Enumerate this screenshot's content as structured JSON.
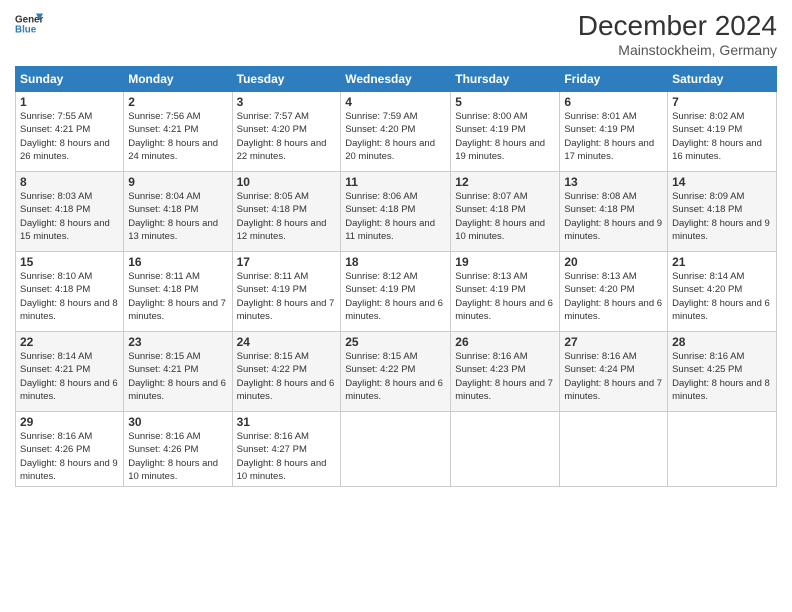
{
  "header": {
    "logo_line1": "General",
    "logo_line2": "Blue",
    "month": "December 2024",
    "location": "Mainstockheim, Germany"
  },
  "days_of_week": [
    "Sunday",
    "Monday",
    "Tuesday",
    "Wednesday",
    "Thursday",
    "Friday",
    "Saturday"
  ],
  "weeks": [
    [
      {
        "day": "1",
        "sunrise": "Sunrise: 7:55 AM",
        "sunset": "Sunset: 4:21 PM",
        "daylight": "Daylight: 8 hours and 26 minutes."
      },
      {
        "day": "2",
        "sunrise": "Sunrise: 7:56 AM",
        "sunset": "Sunset: 4:21 PM",
        "daylight": "Daylight: 8 hours and 24 minutes."
      },
      {
        "day": "3",
        "sunrise": "Sunrise: 7:57 AM",
        "sunset": "Sunset: 4:20 PM",
        "daylight": "Daylight: 8 hours and 22 minutes."
      },
      {
        "day": "4",
        "sunrise": "Sunrise: 7:59 AM",
        "sunset": "Sunset: 4:20 PM",
        "daylight": "Daylight: 8 hours and 20 minutes."
      },
      {
        "day": "5",
        "sunrise": "Sunrise: 8:00 AM",
        "sunset": "Sunset: 4:19 PM",
        "daylight": "Daylight: 8 hours and 19 minutes."
      },
      {
        "day": "6",
        "sunrise": "Sunrise: 8:01 AM",
        "sunset": "Sunset: 4:19 PM",
        "daylight": "Daylight: 8 hours and 17 minutes."
      },
      {
        "day": "7",
        "sunrise": "Sunrise: 8:02 AM",
        "sunset": "Sunset: 4:19 PM",
        "daylight": "Daylight: 8 hours and 16 minutes."
      }
    ],
    [
      {
        "day": "8",
        "sunrise": "Sunrise: 8:03 AM",
        "sunset": "Sunset: 4:18 PM",
        "daylight": "Daylight: 8 hours and 15 minutes."
      },
      {
        "day": "9",
        "sunrise": "Sunrise: 8:04 AM",
        "sunset": "Sunset: 4:18 PM",
        "daylight": "Daylight: 8 hours and 13 minutes."
      },
      {
        "day": "10",
        "sunrise": "Sunrise: 8:05 AM",
        "sunset": "Sunset: 4:18 PM",
        "daylight": "Daylight: 8 hours and 12 minutes."
      },
      {
        "day": "11",
        "sunrise": "Sunrise: 8:06 AM",
        "sunset": "Sunset: 4:18 PM",
        "daylight": "Daylight: 8 hours and 11 minutes."
      },
      {
        "day": "12",
        "sunrise": "Sunrise: 8:07 AM",
        "sunset": "Sunset: 4:18 PM",
        "daylight": "Daylight: 8 hours and 10 minutes."
      },
      {
        "day": "13",
        "sunrise": "Sunrise: 8:08 AM",
        "sunset": "Sunset: 4:18 PM",
        "daylight": "Daylight: 8 hours and 9 minutes."
      },
      {
        "day": "14",
        "sunrise": "Sunrise: 8:09 AM",
        "sunset": "Sunset: 4:18 PM",
        "daylight": "Daylight: 8 hours and 9 minutes."
      }
    ],
    [
      {
        "day": "15",
        "sunrise": "Sunrise: 8:10 AM",
        "sunset": "Sunset: 4:18 PM",
        "daylight": "Daylight: 8 hours and 8 minutes."
      },
      {
        "day": "16",
        "sunrise": "Sunrise: 8:11 AM",
        "sunset": "Sunset: 4:18 PM",
        "daylight": "Daylight: 8 hours and 7 minutes."
      },
      {
        "day": "17",
        "sunrise": "Sunrise: 8:11 AM",
        "sunset": "Sunset: 4:19 PM",
        "daylight": "Daylight: 8 hours and 7 minutes."
      },
      {
        "day": "18",
        "sunrise": "Sunrise: 8:12 AM",
        "sunset": "Sunset: 4:19 PM",
        "daylight": "Daylight: 8 hours and 6 minutes."
      },
      {
        "day": "19",
        "sunrise": "Sunrise: 8:13 AM",
        "sunset": "Sunset: 4:19 PM",
        "daylight": "Daylight: 8 hours and 6 minutes."
      },
      {
        "day": "20",
        "sunrise": "Sunrise: 8:13 AM",
        "sunset": "Sunset: 4:20 PM",
        "daylight": "Daylight: 8 hours and 6 minutes."
      },
      {
        "day": "21",
        "sunrise": "Sunrise: 8:14 AM",
        "sunset": "Sunset: 4:20 PM",
        "daylight": "Daylight: 8 hours and 6 minutes."
      }
    ],
    [
      {
        "day": "22",
        "sunrise": "Sunrise: 8:14 AM",
        "sunset": "Sunset: 4:21 PM",
        "daylight": "Daylight: 8 hours and 6 minutes."
      },
      {
        "day": "23",
        "sunrise": "Sunrise: 8:15 AM",
        "sunset": "Sunset: 4:21 PM",
        "daylight": "Daylight: 8 hours and 6 minutes."
      },
      {
        "day": "24",
        "sunrise": "Sunrise: 8:15 AM",
        "sunset": "Sunset: 4:22 PM",
        "daylight": "Daylight: 8 hours and 6 minutes."
      },
      {
        "day": "25",
        "sunrise": "Sunrise: 8:15 AM",
        "sunset": "Sunset: 4:22 PM",
        "daylight": "Daylight: 8 hours and 6 minutes."
      },
      {
        "day": "26",
        "sunrise": "Sunrise: 8:16 AM",
        "sunset": "Sunset: 4:23 PM",
        "daylight": "Daylight: 8 hours and 7 minutes."
      },
      {
        "day": "27",
        "sunrise": "Sunrise: 8:16 AM",
        "sunset": "Sunset: 4:24 PM",
        "daylight": "Daylight: 8 hours and 7 minutes."
      },
      {
        "day": "28",
        "sunrise": "Sunrise: 8:16 AM",
        "sunset": "Sunset: 4:25 PM",
        "daylight": "Daylight: 8 hours and 8 minutes."
      }
    ],
    [
      {
        "day": "29",
        "sunrise": "Sunrise: 8:16 AM",
        "sunset": "Sunset: 4:26 PM",
        "daylight": "Daylight: 8 hours and 9 minutes."
      },
      {
        "day": "30",
        "sunrise": "Sunrise: 8:16 AM",
        "sunset": "Sunset: 4:26 PM",
        "daylight": "Daylight: 8 hours and 10 minutes."
      },
      {
        "day": "31",
        "sunrise": "Sunrise: 8:16 AM",
        "sunset": "Sunset: 4:27 PM",
        "daylight": "Daylight: 8 hours and 10 minutes."
      },
      null,
      null,
      null,
      null
    ]
  ]
}
